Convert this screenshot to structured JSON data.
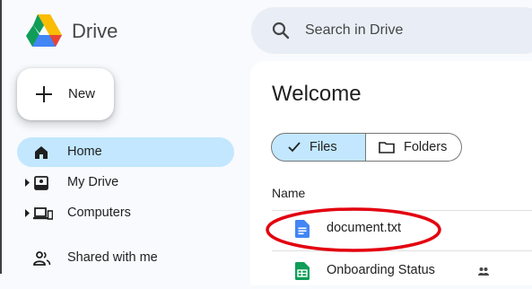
{
  "app": {
    "name": "Drive"
  },
  "search": {
    "placeholder": "Search in Drive"
  },
  "sidebar": {
    "new_label": "New",
    "items": [
      {
        "label": "Home",
        "icon": "home-icon",
        "active": true
      },
      {
        "label": "My Drive",
        "icon": "my-drive-icon",
        "expandable": true
      },
      {
        "label": "Computers",
        "icon": "computers-icon",
        "expandable": true
      },
      {
        "label": "Shared with me",
        "icon": "shared-icon"
      }
    ]
  },
  "main": {
    "title": "Welcome",
    "filter": {
      "files_label": "Files",
      "folders_label": "Folders",
      "selected": "Files"
    },
    "table": {
      "column_name": "Name",
      "rows": [
        {
          "name": "document.txt",
          "icon": "doc-file-icon"
        },
        {
          "name": "Onboarding Status",
          "icon": "sheet-file-icon",
          "shared": true
        }
      ]
    }
  },
  "colors": {
    "accent": "#c2e7ff",
    "highlight_annotation": "#e3000f",
    "doc_icon": "#4285f4",
    "sheet_icon": "#0f9d58"
  }
}
